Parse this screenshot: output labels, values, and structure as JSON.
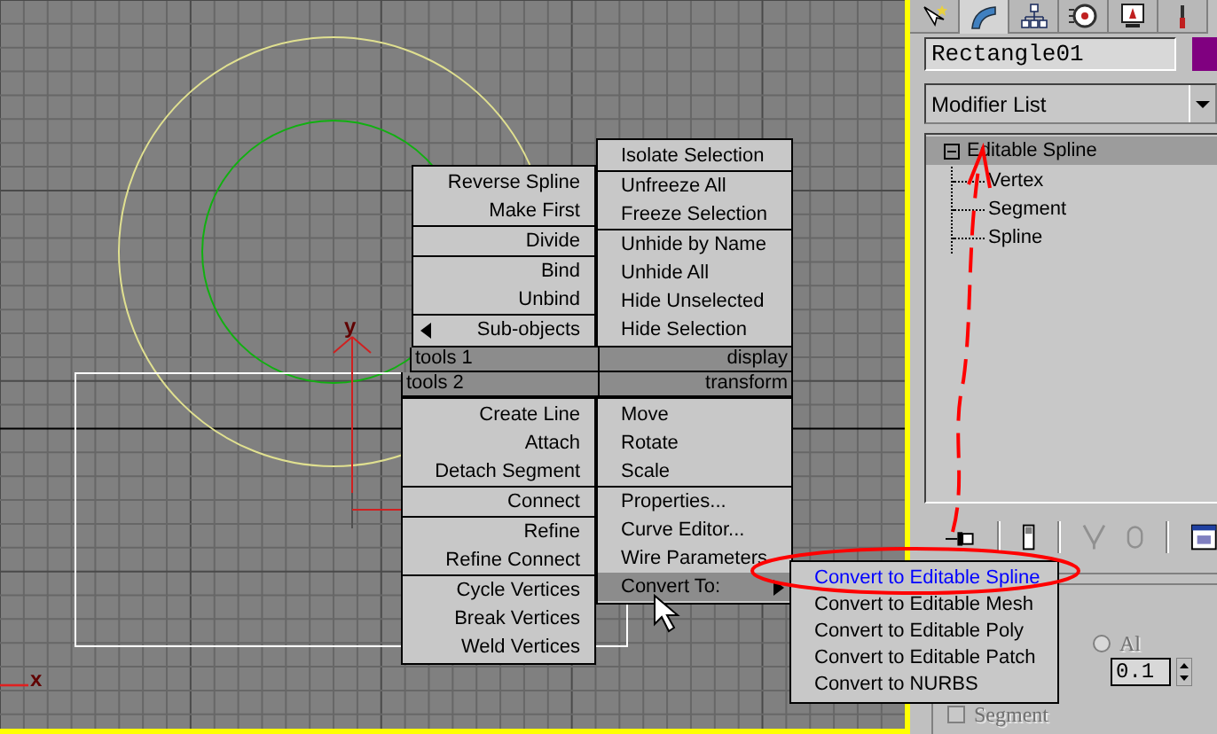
{
  "viewport": {
    "gizmo_axis": "y",
    "corner_axis": "x"
  },
  "quad_menu": {
    "top_row": [
      {
        "groups": [
          [
            {
              "label": "Reverse Spline",
              "selected": false
            },
            {
              "label": "Make First",
              "selected": false
            }
          ],
          [
            {
              "label": "Divide",
              "selected": false
            }
          ],
          [
            {
              "label": "Bind",
              "selected": false
            },
            {
              "label": "Unbind",
              "selected": false
            }
          ],
          [
            {
              "label": "Sub-objects",
              "selected": false,
              "submenu": true
            }
          ]
        ]
      },
      {
        "groups": [
          [
            {
              "label": "Isolate Selection",
              "selected": false
            }
          ],
          [
            {
              "label": "Unfreeze All",
              "selected": false
            },
            {
              "label": "Freeze Selection",
              "selected": false
            }
          ],
          [
            {
              "label": "Unhide by Name",
              "selected": false
            },
            {
              "label": "Unhide All",
              "selected": false
            },
            {
              "label": "Hide Unselected",
              "selected": false
            },
            {
              "label": "Hide Selection",
              "selected": false
            }
          ]
        ]
      }
    ],
    "headers": [
      {
        "left": "tools 1",
        "right": "display"
      },
      {
        "left": "tools 2",
        "right": "transform"
      }
    ],
    "bottom_row": [
      {
        "groups": [
          [
            {
              "label": "Create Line",
              "selected": false
            },
            {
              "label": "Attach",
              "selected": false
            },
            {
              "label": "Detach Segment",
              "selected": false
            }
          ],
          [
            {
              "label": "Connect",
              "selected": false
            }
          ],
          [
            {
              "label": "Refine",
              "selected": false
            },
            {
              "label": "Refine Connect",
              "selected": false
            }
          ],
          [
            {
              "label": "Cycle Vertices",
              "selected": false
            },
            {
              "label": "Break Vertices",
              "selected": false
            },
            {
              "label": "Weld Vertices",
              "selected": false
            }
          ]
        ]
      },
      {
        "groups": [
          [
            {
              "label": "Move",
              "selected": false
            },
            {
              "label": "Rotate",
              "selected": false
            },
            {
              "label": "Scale",
              "selected": false
            }
          ],
          [
            {
              "label": "Properties...",
              "selected": false
            },
            {
              "label": "Curve Editor...",
              "selected": false
            },
            {
              "label": "Wire Parameters",
              "selected": false
            },
            {
              "label": "Convert To:",
              "selected": true,
              "submenu": true
            }
          ]
        ]
      }
    ],
    "submenu": [
      {
        "label": "Convert to Editable Spline",
        "selected": true
      },
      {
        "label": "Convert to Editable Mesh",
        "selected": false
      },
      {
        "label": "Convert to Editable Poly",
        "selected": false
      },
      {
        "label": "Convert to Editable Patch",
        "selected": false
      },
      {
        "label": "Convert to NURBS",
        "selected": false
      }
    ]
  },
  "command_panel": {
    "tabs": [
      {
        "kind": "create",
        "selected": false
      },
      {
        "kind": "modify",
        "selected": true
      },
      {
        "kind": "hierarchy",
        "selected": false
      },
      {
        "kind": "motion",
        "selected": false
      },
      {
        "kind": "display",
        "selected": false
      },
      {
        "kind": "utilities",
        "selected": false
      }
    ],
    "object": {
      "name": "Rectangle01",
      "color": "#800080"
    },
    "modifier_list": "Modifier List",
    "stack": [
      {
        "label": "Editable Spline",
        "selected": true,
        "expanded": true,
        "children": [
          {
            "label": "Vertex",
            "selected": false
          },
          {
            "label": "Segment",
            "selected": false
          },
          {
            "label": "Spline",
            "selected": false
          }
        ]
      }
    ],
    "rollout": {
      "radio": {
        "label": "Al",
        "checked": false,
        "disabled": true
      },
      "spinner": "0.1",
      "checkbox": {
        "label": "Segment",
        "checked": false,
        "disabled": true
      }
    }
  }
}
